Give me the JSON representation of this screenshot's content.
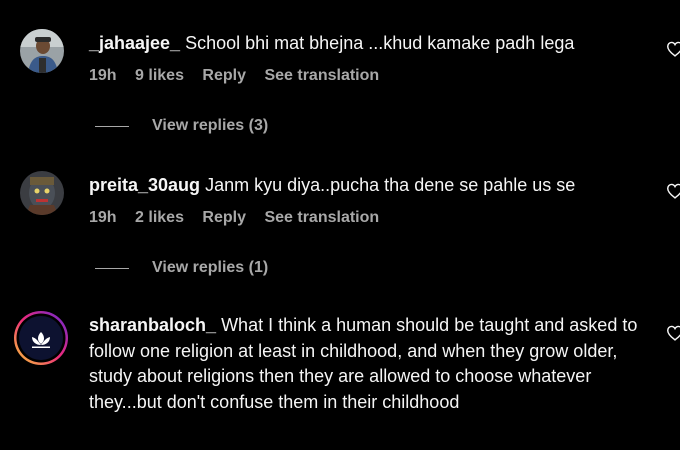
{
  "comments": [
    {
      "username": "_jahaajee_",
      "text": "School bhi mat bhejna ...khud kamake padh lega",
      "time": "19h",
      "likes": "9 likes",
      "reply": "Reply",
      "translation": "See translation",
      "view_replies": "View replies (3)",
      "avatar_icon": "user-photo-avatar",
      "like_icon": "heart-outline-icon"
    },
    {
      "username": "preita_30aug",
      "text": "Janm kyu diya..pucha tha dene se pahle us se",
      "time": "19h",
      "likes": "2 likes",
      "reply": "Reply",
      "translation": "See translation",
      "view_replies": "View replies (1)",
      "avatar_icon": "user-photo-avatar",
      "like_icon": "heart-outline-icon"
    },
    {
      "username": "sharanbaloch_",
      "text": "What I think a human should be taught and asked to follow one religion at least in childhood, and when they grow older, study about religions then they are allowed to choose whatever they...but don't confuse them in their childhood",
      "avatar_icon": "lotus-logo-avatar",
      "like_icon": "heart-outline-icon"
    }
  ],
  "colors": {
    "background": "#000000",
    "primary_text": "#f5f5f5",
    "secondary_text": "#a8a8a8"
  }
}
